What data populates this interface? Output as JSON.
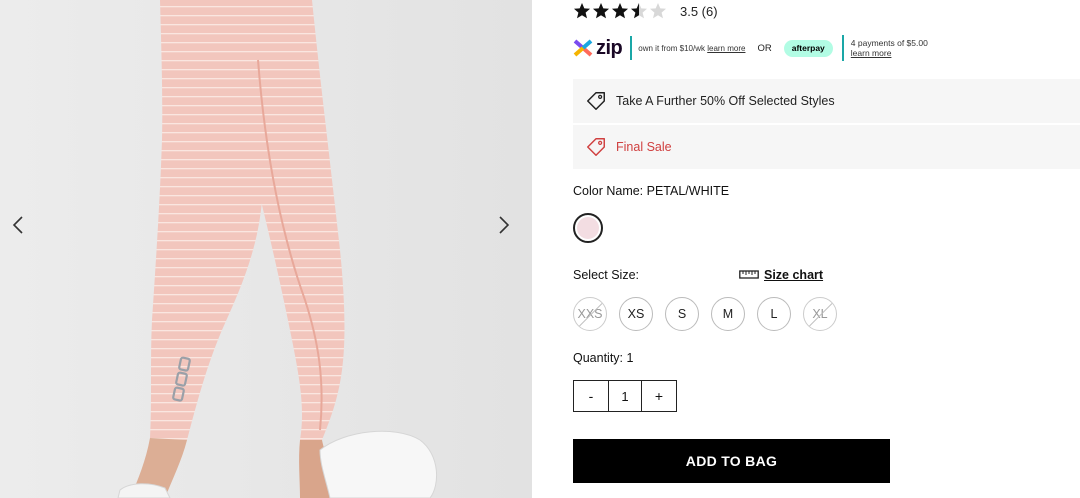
{
  "gallery": {
    "alt": "product image of leggings"
  },
  "rating": {
    "value": 3.5,
    "text": "3.5 (6)"
  },
  "payments": {
    "zip_logo": "zip",
    "zip_text": "own it from $10/wk",
    "zip_learn": "learn more",
    "or": "OR",
    "afterpay_logo": "afterpay",
    "afterpay_text": "4 payments of $5.00",
    "afterpay_learn": "learn more"
  },
  "promos": {
    "promo1": "Take A Further 50% Off Selected Styles",
    "promo2": "Final Sale"
  },
  "color": {
    "label": "Color Name: PETAL/WHITE",
    "swatch_hex": "#f3dde2"
  },
  "size": {
    "label": "Select Size:",
    "chart_label": "Size chart",
    "options": [
      {
        "label": "XXS",
        "available": false
      },
      {
        "label": "XS",
        "available": true
      },
      {
        "label": "S",
        "available": true
      },
      {
        "label": "M",
        "available": true
      },
      {
        "label": "L",
        "available": true
      },
      {
        "label": "XL",
        "available": false
      }
    ]
  },
  "quantity": {
    "label": "Quantity: 1",
    "minus": "-",
    "value": "1",
    "plus": "+"
  },
  "add_to_bag": "ADD TO BAG",
  "colors": {
    "accent_teal": "#1aa7a7",
    "afterpay_mint": "#b2fce4",
    "sale_red": "#d04040"
  }
}
